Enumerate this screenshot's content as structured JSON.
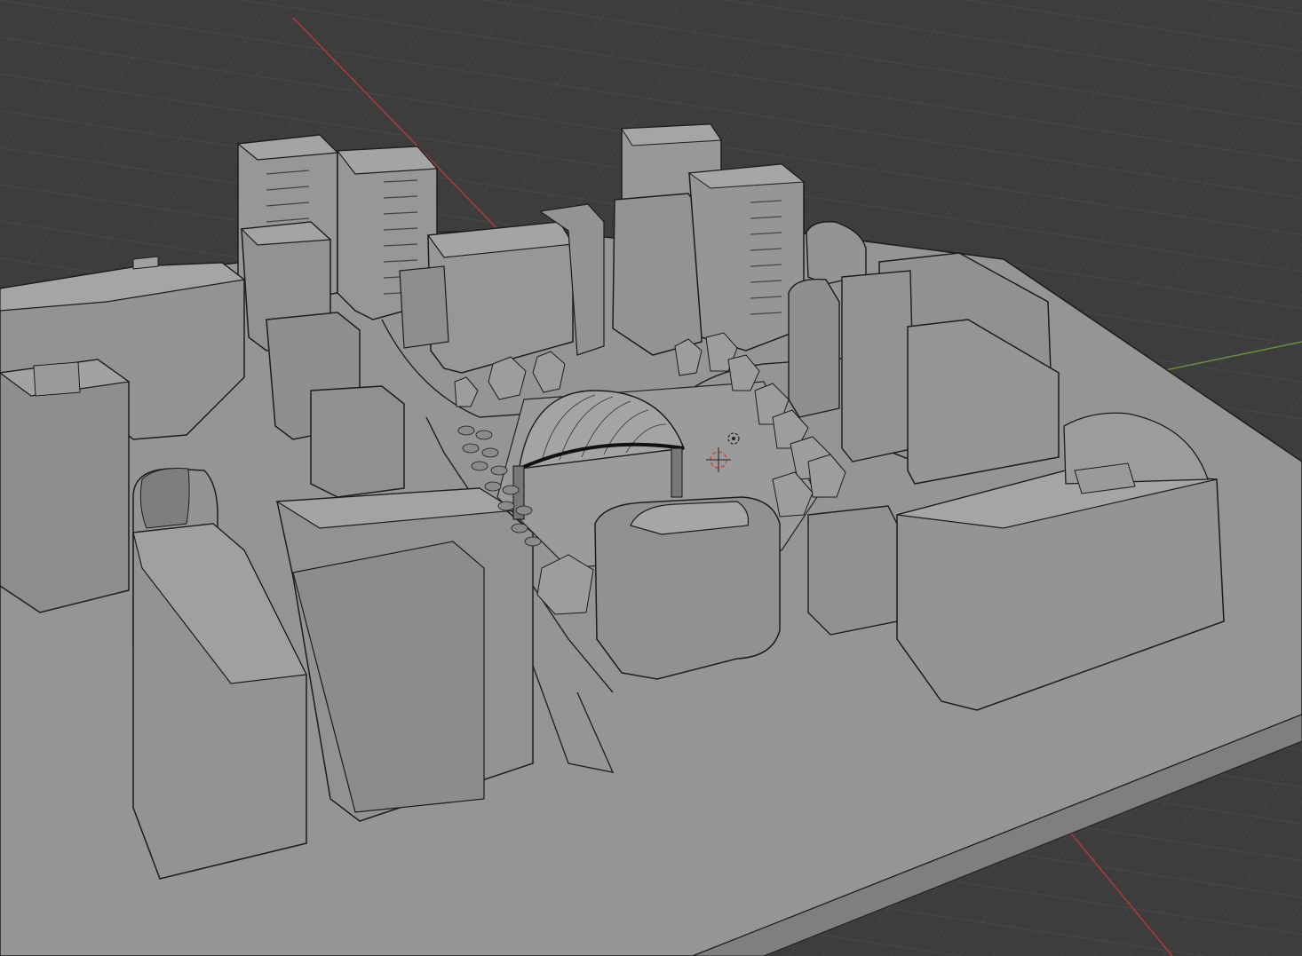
{
  "viewport": {
    "background": "#3d3d3d",
    "grid_color": "#4a4a4a",
    "axis_x_color": "#c0393b",
    "axis_y_color": "#6e9a3a",
    "mesh_color": "#9a9a9a",
    "edge_color": "#1c1c1c"
  },
  "scene": {
    "object": "city-block-model",
    "center_feature": "dome-pavilion"
  }
}
